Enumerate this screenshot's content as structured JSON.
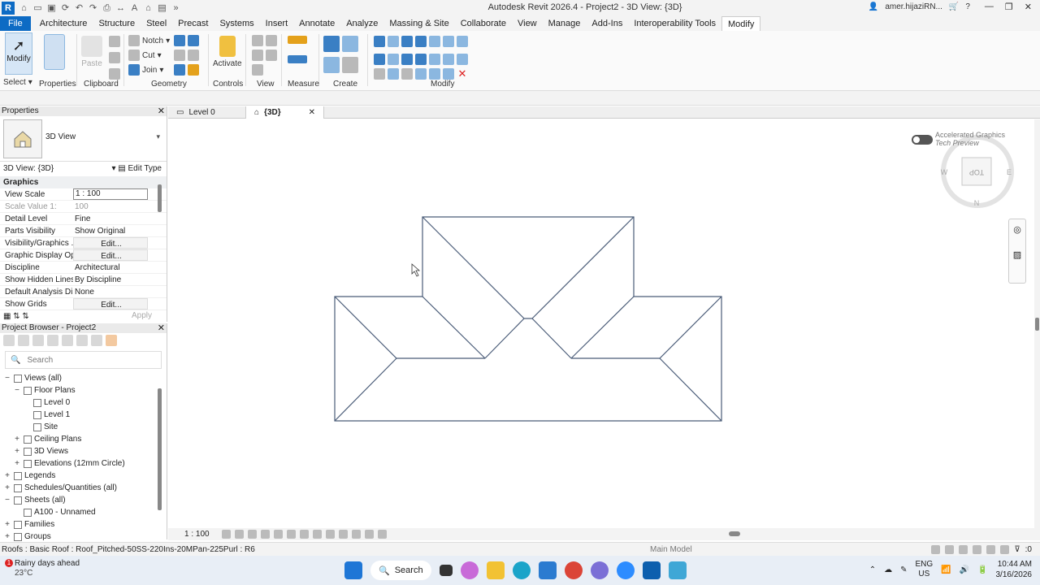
{
  "window": {
    "title": "Autodesk Revit 2026.4 - Project2 - 3D View: {3D}",
    "user": "amer.hijaziRN...",
    "logo": "R"
  },
  "ribbon_tabs": [
    "File",
    "Architecture",
    "Structure",
    "Steel",
    "Precast",
    "Systems",
    "Insert",
    "Annotate",
    "Analyze",
    "Massing & Site",
    "Collaborate",
    "View",
    "Manage",
    "Add-Ins",
    "Interoperability Tools",
    "Modify"
  ],
  "ribbon": {
    "modify_label": "Modify",
    "select_label": "Select",
    "properties_label": "Properties",
    "paste_label": "Paste",
    "notch_label": "Notch",
    "cut_label": "Cut",
    "join_label": "Join",
    "activate_label": "Activate",
    "groups": [
      "Select",
      "Properties",
      "Clipboard",
      "Geometry",
      "Controls",
      "View",
      "Measure",
      "Create",
      "Modify"
    ]
  },
  "properties": {
    "header": "Properties",
    "type_name": "3D View",
    "filter": "3D View: {3D}",
    "edit_type": "Edit Type",
    "section": "Graphics",
    "rows": [
      {
        "name": "View Scale",
        "value": "1 : 100"
      },
      {
        "name": "Scale Value    1:",
        "value": "100"
      },
      {
        "name": "Detail Level",
        "value": "Fine"
      },
      {
        "name": "Parts Visibility",
        "value": "Show Original"
      },
      {
        "name": "Visibility/Graphics ...",
        "value": "Edit..."
      },
      {
        "name": "Graphic Display Op...",
        "value": "Edit..."
      },
      {
        "name": "Discipline",
        "value": "Architectural"
      },
      {
        "name": "Show Hidden Lines",
        "value": "By Discipline"
      },
      {
        "name": "Default Analysis Dis...",
        "value": "None"
      },
      {
        "name": "Show Grids",
        "value": "Edit..."
      }
    ],
    "apply": "Apply"
  },
  "browser": {
    "header": "Project Browser - Project2",
    "search_placeholder": "Search",
    "items": [
      {
        "label": "Views (all)",
        "level": 0,
        "toggle": "−"
      },
      {
        "label": "Floor Plans",
        "level": 1,
        "toggle": "−"
      },
      {
        "label": "Level 0",
        "level": 2,
        "toggle": ""
      },
      {
        "label": "Level 1",
        "level": 2,
        "toggle": ""
      },
      {
        "label": "Site",
        "level": 2,
        "toggle": ""
      },
      {
        "label": "Ceiling Plans",
        "level": 1,
        "toggle": "+"
      },
      {
        "label": "3D Views",
        "level": 1,
        "toggle": "+"
      },
      {
        "label": "Elevations (12mm Circle)",
        "level": 1,
        "toggle": "+"
      },
      {
        "label": "Legends",
        "level": 0,
        "toggle": "+"
      },
      {
        "label": "Schedules/Quantities (all)",
        "level": 0,
        "toggle": "+"
      },
      {
        "label": "Sheets (all)",
        "level": 0,
        "toggle": "−"
      },
      {
        "label": "A100 - Unnamed",
        "level": 1,
        "toggle": ""
      },
      {
        "label": "Families",
        "level": 0,
        "toggle": "+"
      },
      {
        "label": "Groups",
        "level": 0,
        "toggle": "+"
      }
    ]
  },
  "view_tabs": [
    {
      "label": "Level 0",
      "active": false
    },
    {
      "label": "{3D}",
      "active": true
    }
  ],
  "canvas": {
    "accel_line1": "Accelerated Graphics",
    "accel_line2": "Tech Preview",
    "viewcube_face": "TOP",
    "compass_n": "N",
    "compass_w": "W",
    "compass_e": "E"
  },
  "view_control": {
    "scale": "1 : 100"
  },
  "status": {
    "text": "Roofs : Basic Roof : Roof_Pitched-50SS-220Ins-20MPan-225Purl : R6",
    "model": "Main Model",
    "count": ":0"
  },
  "taskbar": {
    "weather_title": "Rainy days ahead",
    "weather_temp": "23°C",
    "badge": "1",
    "search": "Search",
    "lang1": "ENG",
    "lang2": "US",
    "time": "10:44 AM",
    "date": "3/16/2026"
  }
}
